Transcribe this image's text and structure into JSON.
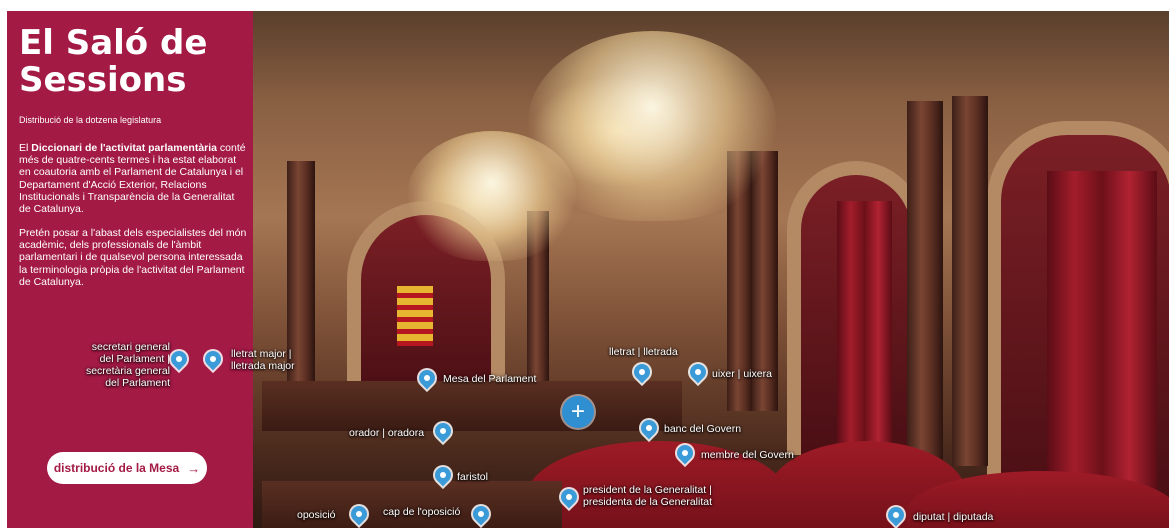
{
  "panel": {
    "title_line1": "El Saló de",
    "title_line2": "Sessions",
    "subtitle": "Distribució de la dotzena legislatura",
    "p1_bold": "Diccionari de l'activitat parlamentària",
    "p1_pre": "El ",
    "p1_rest": " conté més de quatre-cents termes i ha estat elaborat en coautoria amb el Parlament de Catalunya i el Departament d'Acció Exterior, Relacions Institucionals i Transparència de la Generalitat de Catalunya.",
    "p2": "Pretén posar a l'abast dels especialistes del món acadèmic, dels professionals de l'àmbit parlamentari i de qualsevol persona interessada la terminologia pròpia de l'activitat del Parlament de Catalunya.",
    "mesa_button": "distribució de la Mesa",
    "mesa_arrow": "→"
  },
  "hotspots": {
    "secretari": "secretari general\ndel Parlament |\nsecretària general\ndel Parlament",
    "lletrat_major": "lletrat major |\nlletrada major",
    "mesa": "Mesa del Parlament",
    "lletrat": "lletrat | lletrada",
    "uixer": "uixer | uixera",
    "orador": "orador | oradora",
    "banc": "banc del Govern",
    "membre": "membre del Govern",
    "faristol": "faristol",
    "president": "president de la Generalitat |\npresidenta de la Generalitat",
    "oposicio": "oposició",
    "cap_oposicio": "cap de l'oposició",
    "diputat": "diputat | diputada"
  },
  "plus_symbol": "+",
  "colors": {
    "panel": "#a31a45",
    "pin": "#3b9bd8",
    "plus": "#2f8fd1"
  }
}
